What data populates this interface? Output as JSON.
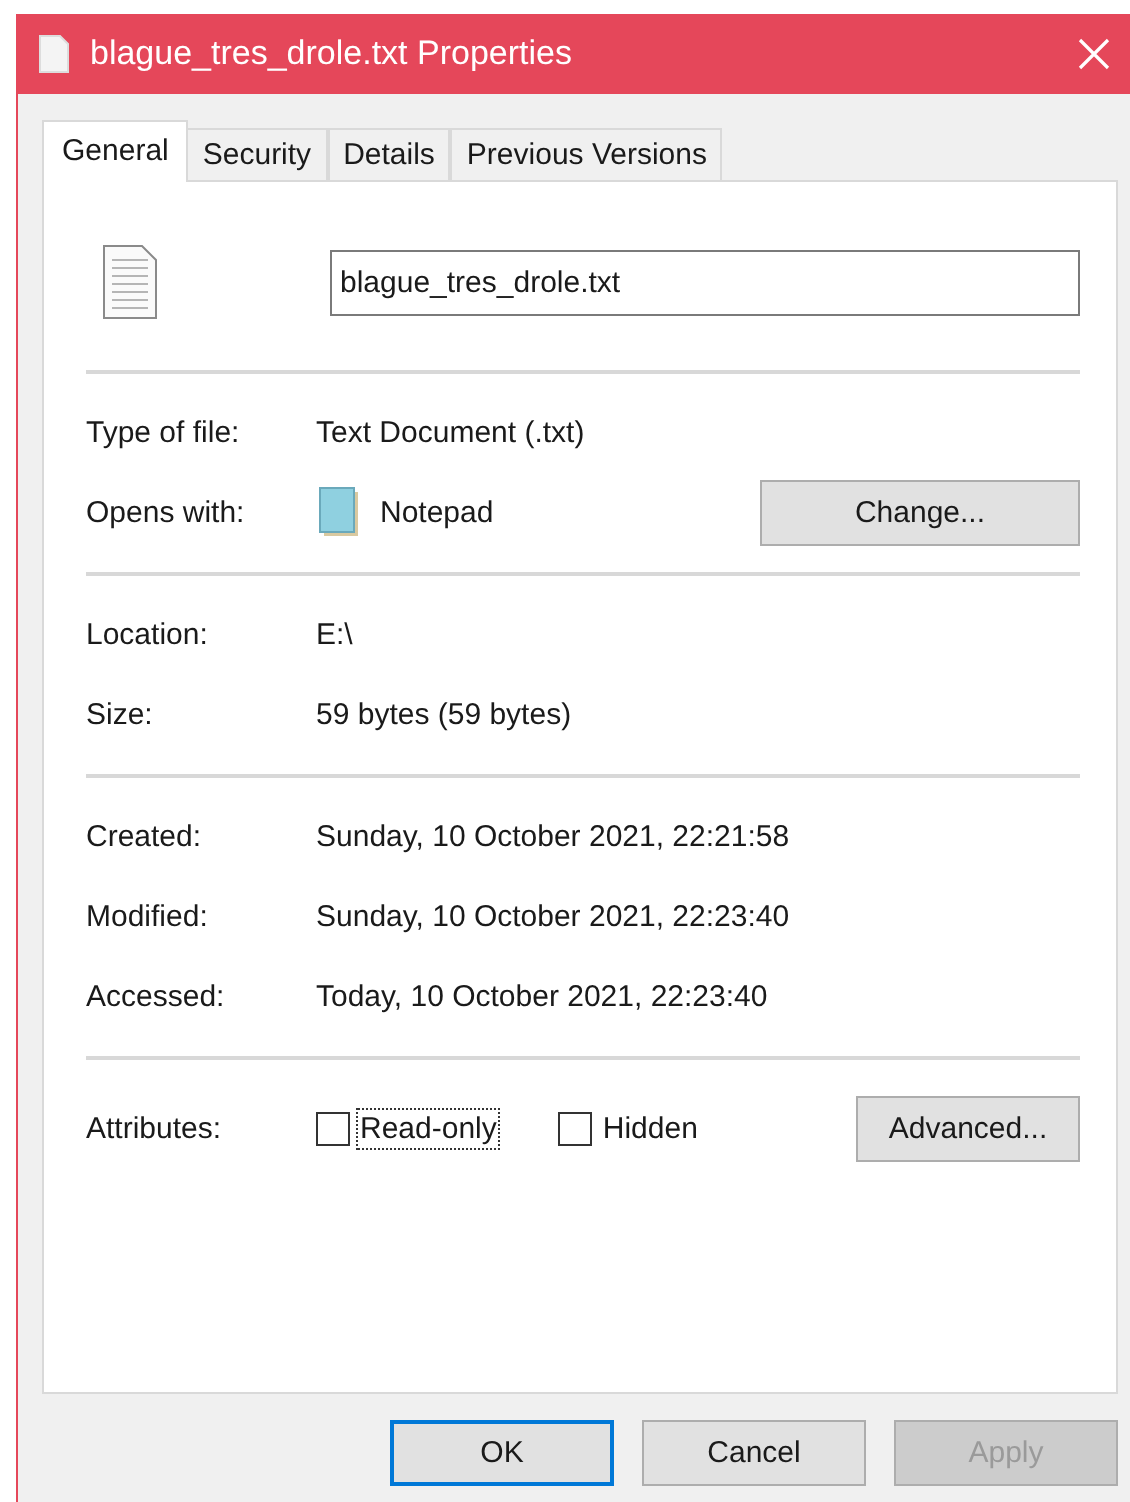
{
  "window": {
    "title": "blague_tres_drole.txt Properties"
  },
  "tabs": [
    {
      "label": "General",
      "selected": true
    },
    {
      "label": "Security",
      "selected": false
    },
    {
      "label": "Details",
      "selected": false
    },
    {
      "label": "Previous Versions",
      "selected": false
    }
  ],
  "file_name": {
    "value": "blague_tres_drole.txt"
  },
  "sections": [
    {
      "rows": [
        {
          "label": "Type of file:",
          "value": "Text Document (.txt)"
        },
        {
          "label": "Opens with:",
          "value": "Notepad",
          "kind": "app",
          "button": "Change..."
        }
      ]
    },
    {
      "rows": [
        {
          "label": "Location:",
          "value": "E:\\"
        },
        {
          "label": "Size:",
          "value": "59 bytes (59 bytes)"
        }
      ]
    },
    {
      "rows": [
        {
          "label": "Created:",
          "value": "Sunday, 10 October 2021, 22:21:58"
        },
        {
          "label": "Modified:",
          "value": "Sunday, 10 October 2021, 22:23:40"
        },
        {
          "label": "Accessed:",
          "value": "Today, 10 October 2021, 22:23:40"
        }
      ]
    }
  ],
  "attributes": {
    "label": "Attributes:",
    "checkboxes": [
      {
        "label": "Read-only",
        "checked": false,
        "focused": true
      },
      {
        "label": "Hidden",
        "checked": false,
        "focused": false
      }
    ],
    "button": "Advanced..."
  },
  "buttons": [
    {
      "label": "OK",
      "default": true,
      "disabled": false
    },
    {
      "label": "Cancel",
      "default": false,
      "disabled": false
    },
    {
      "label": "Apply",
      "default": false,
      "disabled": true
    }
  ]
}
